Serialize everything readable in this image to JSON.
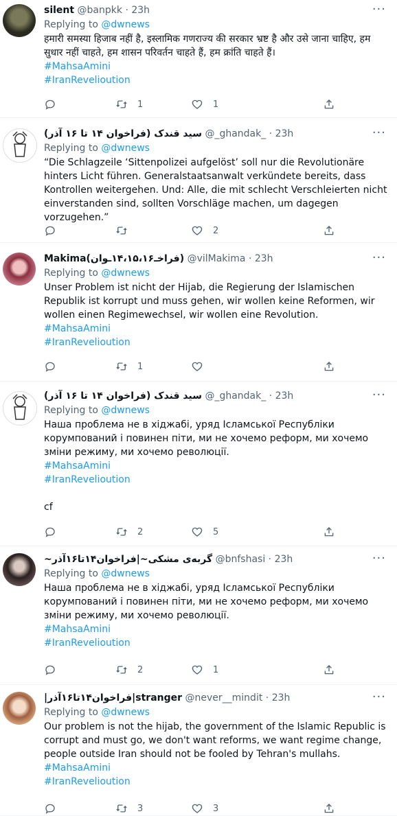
{
  "tweets": [
    {
      "name": "silent",
      "handle": "@banpkk",
      "time": "23h",
      "replying_label": "Replying to",
      "replying_to": "@dwnews",
      "text": "हमारी समस्या हिजाब नहीं है, इस्लामिक गणराज्य की सरकार भ्रष्ट है और उसे जाना चाहिए, हम सुधार नहीं चाहते, हम शासन परिवर्तन चाहते हैं, हम क्रांति चाहते हैं।",
      "hashtags": [
        "#MahsaAmini",
        "#IranRevelioution"
      ],
      "replies": "",
      "retweets": "1",
      "likes": "1"
    },
    {
      "name": "(فراخوان ۱۴ تا ۱۶ آذر) سید قندک",
      "handle": "@_ghandak_",
      "time": "23h",
      "replying_label": "Replying to",
      "replying_to": "@dwnews",
      "text": "“Die Schlagzeile ‘Sittenpolizei aufgelöst’ soll nur die Revolutionäre hinters Licht führen. Generalstaatsanwalt verkündete bereits, dass Kontrollen weitergehen. Und: Alle, die mit schlecht Verschleierten nicht einverstanden sind, sollten Vorschläge machen, um dagegen vorzugehen.”",
      "hashtags": [],
      "replies": "",
      "retweets": "",
      "likes": "2"
    },
    {
      "name": "Makima(فراخـ۱۴،۱۵،۱۶ـوان)",
      "handle": "@vilMakima",
      "time": "23h",
      "replying_label": "Replying to",
      "replying_to": "@dwnews",
      "text": "Unser Problem ist nicht der Hijab, die Regierung der Islamischen Republik ist korrupt und muss gehen, wir wollen keine Reformen, wir wollen einen Regimewechsel, wir wollen eine Revolution.",
      "hashtags": [
        "#MahsaAmini",
        "#IranRevelioution"
      ],
      "replies": "",
      "retweets": "1",
      "likes": ""
    },
    {
      "name": "(فراخوان ۱۴ تا ۱۶ آذر) سید قندک",
      "handle": "@_ghandak_",
      "time": "23h",
      "replying_label": "Replying to",
      "replying_to": "@dwnews",
      "text": "Наша проблема не в хіджабі, уряд Ісламської Республіки корумпований і повинен піти, ми не хочемо реформ, ми хочемо зміни режиму, ми хочемо революції.",
      "hashtags": [
        "#MahsaAmini",
        "#IranRevelioution"
      ],
      "extra": "cf",
      "replies": "",
      "retweets": "2",
      "likes": "5"
    },
    {
      "name": "~گربه‌ی مشکی~|فراخوان۱۴تا۱۶آذر",
      "handle": "@bnfshasi",
      "time": "23h",
      "replying_label": "Replying to",
      "replying_to": "@dwnews",
      "text": "Наша проблема не в хіджабі, уряд Ісламської Республіки корумпований і повинен піти, ми не хочемо реформ, ми хочемо зміни режиму, ми хочемо революції.",
      "hashtags": [
        "#MahsaAmini",
        "#IranRevelioution"
      ],
      "replies": "",
      "retweets": "2",
      "likes": "1"
    },
    {
      "name": "|فراخوان۱۴تا۱۶آذر|stranger",
      "handle": "@never__mindit",
      "time": "23h",
      "replying_label": "Replying to",
      "replying_to": "@dwnews",
      "text": "Our problem is not the hijab, the government of the Islamic Republic is corrupt and must go, we don't want reforms, we want regime change, people outside Iran should not be fooled by Tehran's mullahs.",
      "hashtags": [
        "#MahsaAmini",
        "#IranRevelioution"
      ],
      "replies": "",
      "retweets": "3",
      "likes": "3"
    }
  ],
  "icons": {
    "reply": "reply-icon",
    "retweet": "retweet-icon",
    "like": "heart-icon",
    "share": "share-icon",
    "more": "more-icon"
  },
  "more_label": "···",
  "colors": {
    "link": "#1d9bf0",
    "muted": "#536471",
    "text": "#0f1419",
    "divider": "#eff3f4"
  }
}
